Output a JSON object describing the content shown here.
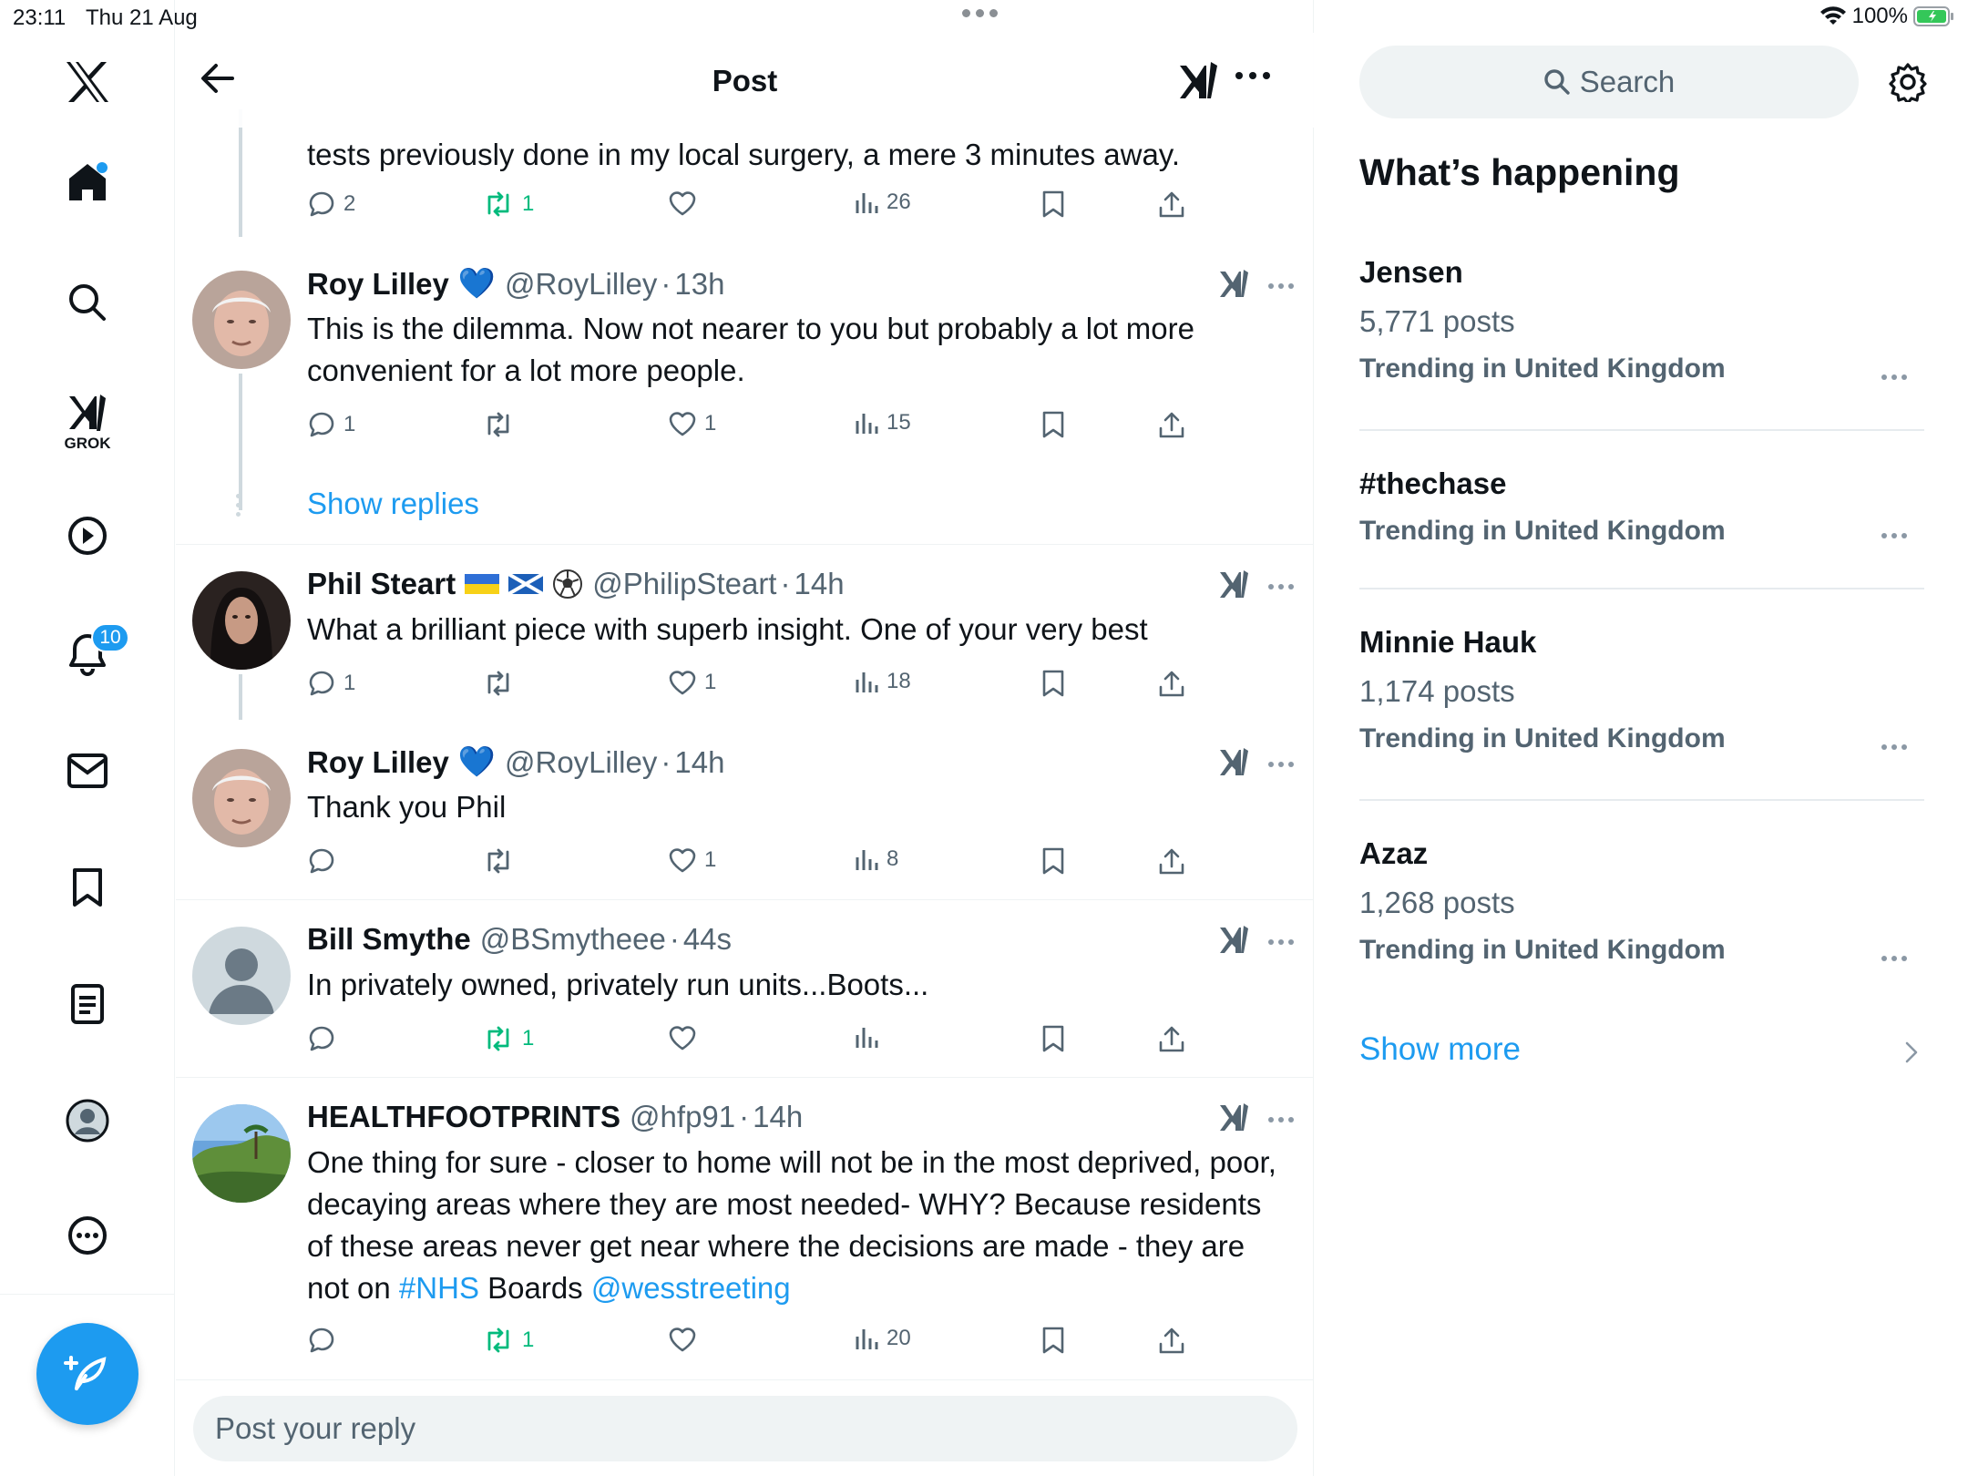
{
  "status_bar": {
    "time": "23:11",
    "date": "Thu 21 Aug",
    "battery": "100%"
  },
  "nav": {
    "grok_label": "GROK",
    "notifications_count": "10"
  },
  "header": {
    "title": "Post"
  },
  "posts": [
    {
      "text": "tests previously done in my local surgery, a mere 3 minutes away.",
      "replies": "2",
      "reposts": "1",
      "likes": "",
      "views": "26"
    },
    {
      "name": "Roy Lilley",
      "emoji": "💙",
      "handle": "@RoyLilley",
      "sep": "·",
      "time": "13h",
      "text": "This is the dilemma. Now not nearer to you but probably a lot more convenient for a lot more people.",
      "replies": "1",
      "reposts": "",
      "likes": "1",
      "views": "15"
    },
    {
      "name": "Phil Steart",
      "handle": "@PhilipSteart",
      "sep": "·",
      "time": "14h",
      "text": "What a brilliant piece with superb insight. One of your very best",
      "replies": "1",
      "reposts": "",
      "likes": "1",
      "views": "18"
    },
    {
      "name": "Roy Lilley",
      "emoji": "💙",
      "handle": "@RoyLilley",
      "sep": "·",
      "time": "14h",
      "text": "Thank you Phil",
      "replies": "",
      "reposts": "",
      "likes": "1",
      "views": "8"
    },
    {
      "name": "Bill Smythe",
      "handle": "@BSmytheee",
      "sep": "·",
      "time": "44s",
      "text": "In privately owned, privately run units...Boots...",
      "replies": "",
      "reposts": "1",
      "likes": "",
      "views": ""
    },
    {
      "name": "HEALTHFOOTPRINTS",
      "handle": "@hfp91",
      "sep": "·",
      "time": "14h",
      "text_before": "One thing for sure - closer to home will not be in the most deprived, poor, decaying areas where they are most needed- WHY? Because residents of these areas never get near where the decisions are made - they are not on ",
      "hashtag": "#NHS",
      "text_middle": " Boards ",
      "mention": "@wesstreeting",
      "replies": "",
      "reposts": "1",
      "likes": "",
      "views": "20"
    }
  ],
  "show_replies": "Show replies",
  "reply_placeholder": "Post your reply",
  "search": {
    "placeholder": "Search"
  },
  "whats_happening": "What’s happening",
  "trends": [
    {
      "title": "Jensen",
      "count": "5,771 posts",
      "context": "Trending in United Kingdom"
    },
    {
      "title": "#thechase",
      "count": "",
      "context": "Trending in United Kingdom"
    },
    {
      "title": "Minnie Hauk",
      "count": "1,174 posts",
      "context": "Trending in United Kingdom"
    },
    {
      "title": "Azaz",
      "count": "1,268 posts",
      "context": "Trending in United Kingdom"
    }
  ],
  "show_more": "Show more",
  "colors": {
    "accent": "#1d9bf0",
    "repost_green": "#00ba7c",
    "muted": "#536471"
  }
}
